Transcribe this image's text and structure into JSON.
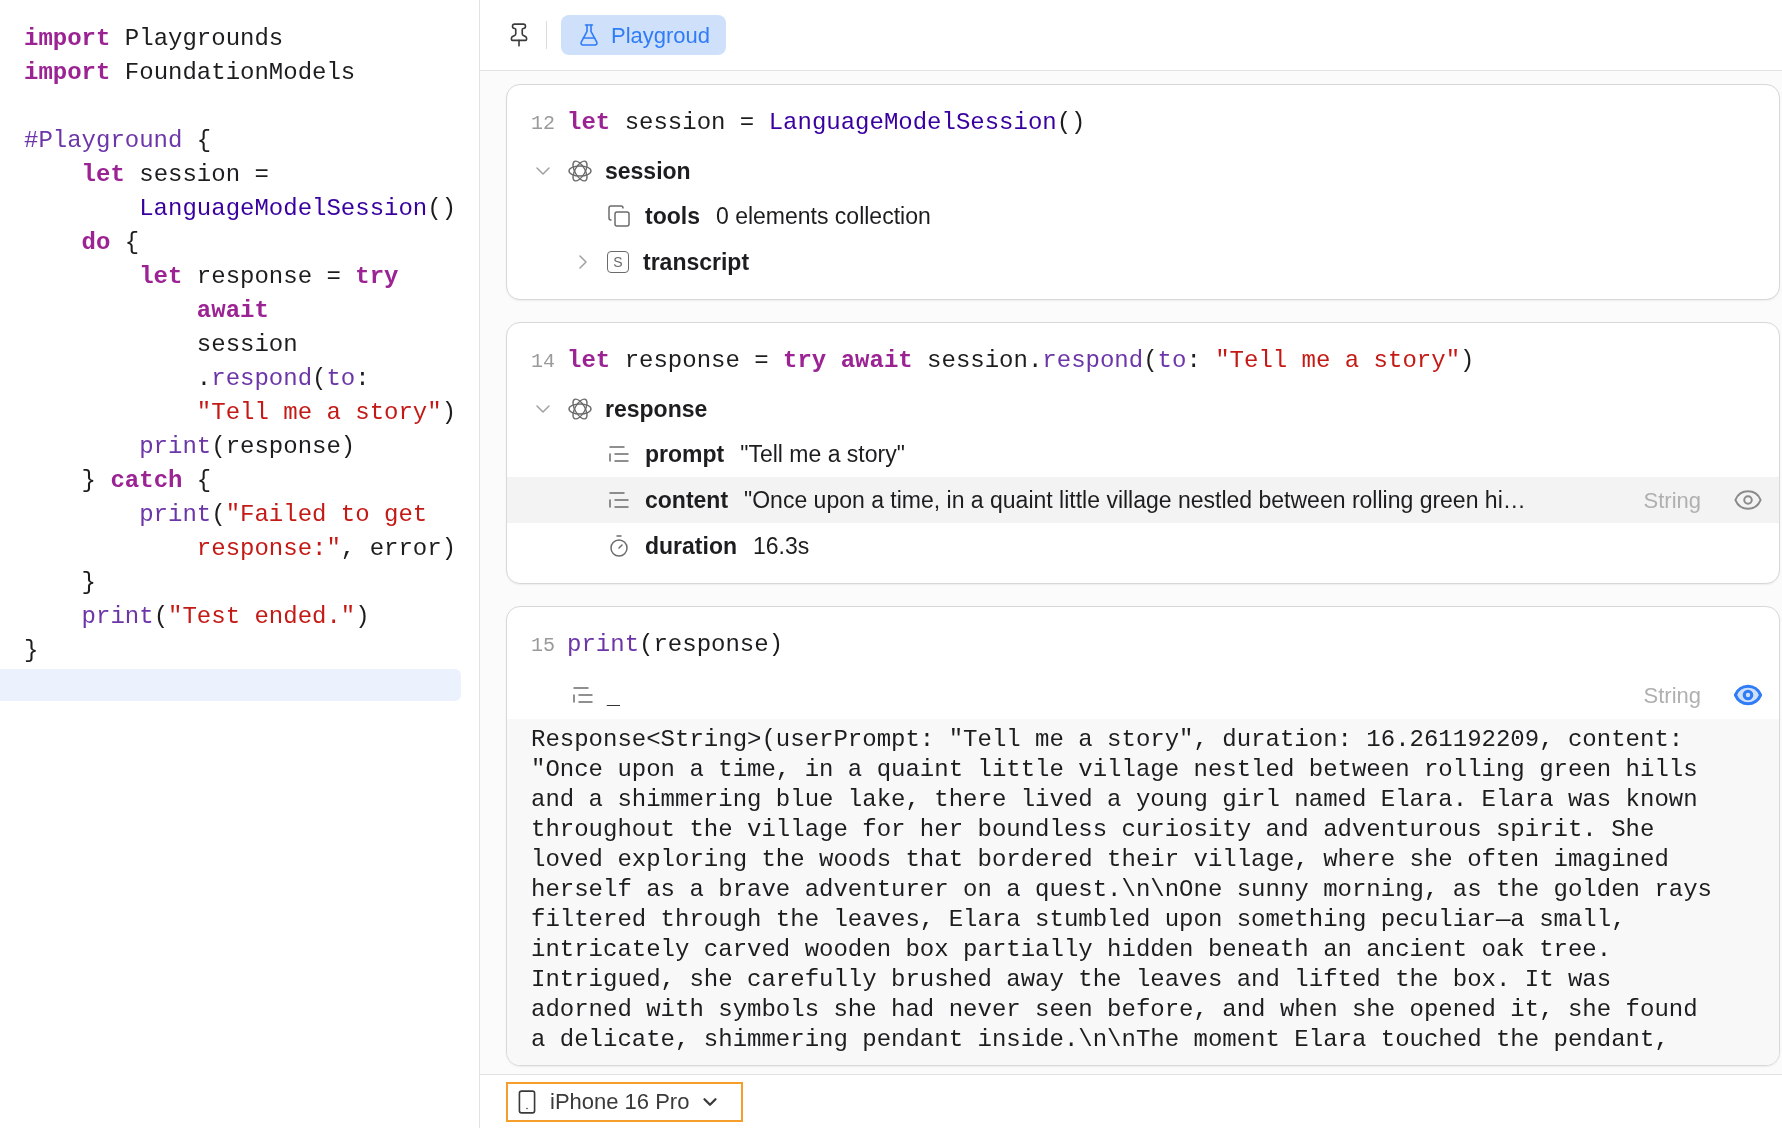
{
  "editor": {
    "lines": [
      {
        "tokens": [
          {
            "text": "import",
            "kind": "keyword"
          },
          {
            "text": " Playgrounds",
            "kind": "plain"
          }
        ]
      },
      {
        "tokens": [
          {
            "text": "import",
            "kind": "keyword"
          },
          {
            "text": " FoundationModels",
            "kind": "plain"
          }
        ]
      },
      {
        "gap_before": true,
        "tokens": [
          {
            "text": "#Playground",
            "kind": "macro"
          },
          {
            "text": " {",
            "kind": "plain"
          }
        ]
      },
      {
        "tokens": [
          {
            "text": "    let",
            "kind": "keyword"
          },
          {
            "text": " session =",
            "kind": "plain"
          }
        ]
      },
      {
        "tokens": [
          {
            "text": "        LanguageModelSession",
            "kind": "type"
          },
          {
            "text": "()",
            "kind": "plain"
          }
        ]
      },
      {
        "tokens": [
          {
            "text": "    do",
            "kind": "keyword"
          },
          {
            "text": " {",
            "kind": "plain"
          }
        ]
      },
      {
        "tokens": [
          {
            "text": "        let",
            "kind": "keyword"
          },
          {
            "text": " response = ",
            "kind": "plain"
          },
          {
            "text": "try",
            "kind": "keyword"
          }
        ]
      },
      {
        "tokens": [
          {
            "text": "            await",
            "kind": "keyword"
          }
        ]
      },
      {
        "tokens": [
          {
            "text": "            session",
            "kind": "plain"
          }
        ]
      },
      {
        "tokens": [
          {
            "text": "            .",
            "kind": "plain"
          },
          {
            "text": "respond",
            "kind": "function"
          },
          {
            "text": "(",
            "kind": "plain"
          },
          {
            "text": "to",
            "kind": "function"
          },
          {
            "text": ":",
            "kind": "plain"
          }
        ]
      },
      {
        "tokens": [
          {
            "text": "            \"Tell me a story\"",
            "kind": "string"
          },
          {
            "text": ")",
            "kind": "plain"
          }
        ]
      },
      {
        "tokens": [
          {
            "text": "        print",
            "kind": "function"
          },
          {
            "text": "(response)",
            "kind": "plain"
          }
        ]
      },
      {
        "tokens": [
          {
            "text": "    } ",
            "kind": "plain"
          },
          {
            "text": "catch",
            "kind": "keyword"
          },
          {
            "text": " {",
            "kind": "plain"
          }
        ]
      },
      {
        "tokens": [
          {
            "text": "        print",
            "kind": "function"
          },
          {
            "text": "(",
            "kind": "plain"
          },
          {
            "text": "\"Failed to get",
            "kind": "string"
          }
        ]
      },
      {
        "tokens": [
          {
            "text": "            response:\"",
            "kind": "string"
          },
          {
            "text": ", error)",
            "kind": "plain"
          }
        ]
      },
      {
        "tokens": [
          {
            "text": "    }",
            "kind": "plain"
          }
        ]
      },
      {
        "tokens": [
          {
            "text": "    print",
            "kind": "function"
          },
          {
            "text": "(",
            "kind": "plain"
          },
          {
            "text": "\"Test ended.\"",
            "kind": "string"
          },
          {
            "text": ")",
            "kind": "plain"
          }
        ]
      },
      {
        "tokens": [
          {
            "text": "}",
            "kind": "plain"
          }
        ]
      }
    ],
    "current_line": true
  },
  "toolbar": {
    "tabs": [
      {
        "label": "Playgroud",
        "selected": true
      }
    ]
  },
  "results": [
    {
      "line_number": "12",
      "code": [
        {
          "text": "let",
          "kind": "keyword"
        },
        {
          "text": " session = ",
          "kind": "plain"
        },
        {
          "text": "LanguageModelSession",
          "kind": "type"
        },
        {
          "text": "()",
          "kind": "plain"
        }
      ],
      "tree": {
        "name": "session",
        "kind": "model",
        "expanded": true,
        "children": [
          {
            "name": "tools",
            "kind": "collection",
            "value": "0 elements collection",
            "selected": false
          },
          {
            "name": "transcript",
            "kind": "struct",
            "badge": "S",
            "expanded": false,
            "selected": false
          }
        ]
      }
    },
    {
      "line_number": "14",
      "code": [
        {
          "text": "let",
          "kind": "keyword"
        },
        {
          "text": " response = ",
          "kind": "plain"
        },
        {
          "text": "try",
          "kind": "keyword"
        },
        {
          "text": " await",
          "kind": "keyword"
        },
        {
          "text": " session.",
          "kind": "plain"
        },
        {
          "text": "respond",
          "kind": "function"
        },
        {
          "text": "(",
          "kind": "plain"
        },
        {
          "text": "to",
          "kind": "function"
        },
        {
          "text": ": ",
          "kind": "plain"
        },
        {
          "text": "\"Tell me a story\"",
          "kind": "string"
        },
        {
          "text": ")",
          "kind": "plain"
        }
      ],
      "tree": {
        "name": "response",
        "kind": "model",
        "expanded": true,
        "children": [
          {
            "name": "prompt",
            "kind": "text",
            "value": "\"Tell me a story\"",
            "selected": false
          },
          {
            "name": "content",
            "kind": "text",
            "value": "\"Once upon a time, in a quaint little village nestled between rolling green hi…",
            "type": "String",
            "preview": false,
            "selected": true
          },
          {
            "name": "duration",
            "kind": "time",
            "value": "16.3s",
            "selected": false
          }
        ]
      }
    },
    {
      "line_number": "15",
      "code": [
        {
          "text": "print",
          "kind": "function"
        },
        {
          "text": "(response)",
          "kind": "plain"
        }
      ],
      "result": {
        "kind": "text",
        "value": "_",
        "type": "String",
        "preview": true
      },
      "output": [
        "Response<String>(userPrompt: \"Tell me a story\", duration: 16.261192209, content:",
        "\"Once upon a time, in a quaint little village nestled between rolling green hills",
        "and a shimmering blue lake, there lived a young girl named Elara. Elara was known",
        "throughout the village for her boundless curiosity and adventurous spirit. She",
        "loved exploring the woods that bordered their village, where she often imagined",
        "herself as a brave adventurer on a quest.\\n\\nOne sunny morning, as the golden rays",
        "filtered through the leaves, Elara stumbled upon something peculiar—a small,",
        "intricately carved wooden box partially hidden beneath an ancient oak tree.",
        "Intrigued, she carefully brushed away the leaves and lifted the box. It was",
        "adorned with symbols she had never seen before, and when she opened it, she found",
        "a delicate, shimmering pendant inside.\\n\\nThe moment Elara touched the pendant,"
      ]
    }
  ],
  "device_bar": {
    "device": "iPhone 16 Pro",
    "focused": true
  }
}
